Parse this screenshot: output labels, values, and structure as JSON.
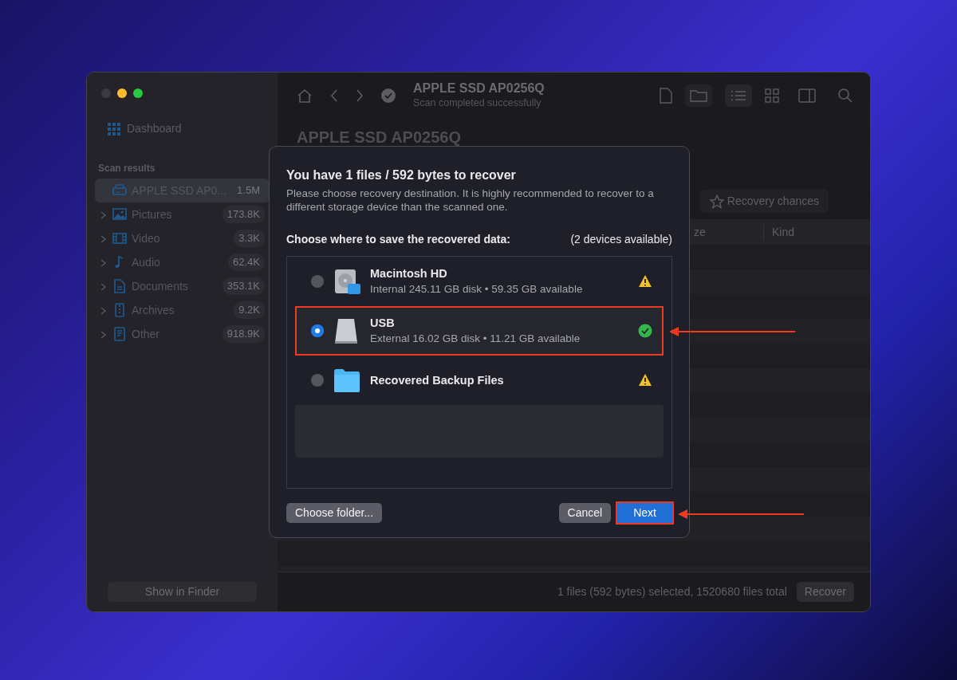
{
  "window": {
    "title": "APPLE SSD AP0256Q",
    "subtitle": "Scan completed successfully"
  },
  "sidebar": {
    "dashboard": "Dashboard",
    "section_title": "Scan results",
    "items": [
      {
        "label": "APPLE SSD AP0...",
        "count": "1.5M",
        "kind": "drive",
        "selected": true,
        "expandable": false
      },
      {
        "label": "Pictures",
        "count": "173.8K",
        "kind": "pictures",
        "selected": false,
        "expandable": true
      },
      {
        "label": "Video",
        "count": "3.3K",
        "kind": "video",
        "selected": false,
        "expandable": true
      },
      {
        "label": "Audio",
        "count": "62.4K",
        "kind": "audio",
        "selected": false,
        "expandable": true
      },
      {
        "label": "Documents",
        "count": "353.1K",
        "kind": "documents",
        "selected": false,
        "expandable": true
      },
      {
        "label": "Archives",
        "count": "9.2K",
        "kind": "archives",
        "selected": false,
        "expandable": true
      },
      {
        "label": "Other",
        "count": "918.9K",
        "kind": "other",
        "selected": false,
        "expandable": true
      }
    ],
    "footer_button": "Show in Finder"
  },
  "content": {
    "heading": "APPLE SSD AP0256Q",
    "filter_button": "Recovery chances",
    "columns": [
      "ze",
      "Kind"
    ]
  },
  "status_bar": {
    "text": "1 files (592 bytes) selected, 1520680 files total",
    "button": "Recover"
  },
  "dialog": {
    "title": "You have 1 files / 592 bytes to recover",
    "description": "Please choose recovery destination. It is highly recommended to recover to a different storage device than the scanned one.",
    "choose_label": "Choose where to save the recovered data:",
    "devices_count": "(2 devices available)",
    "destinations": [
      {
        "name": "Macintosh HD",
        "detail": "Internal 245.11 GB disk • 59.35 GB available",
        "kind": "hdd",
        "recommended": false,
        "selected": false,
        "highlighted": false
      },
      {
        "name": "USB",
        "detail": "External 16.02 GB disk • 11.21 GB available",
        "kind": "usb",
        "recommended": true,
        "selected": true,
        "highlighted": true
      },
      {
        "name": "Recovered Backup Files",
        "kind": "folder",
        "recommended": false,
        "selected": false,
        "highlighted": false
      }
    ],
    "choose_folder": "Choose folder...",
    "buttons": [
      {
        "label": "Cancel",
        "kind": "secondary",
        "highlighted": false
      },
      {
        "label": "Next",
        "kind": "primary",
        "highlighted": true
      }
    ]
  }
}
